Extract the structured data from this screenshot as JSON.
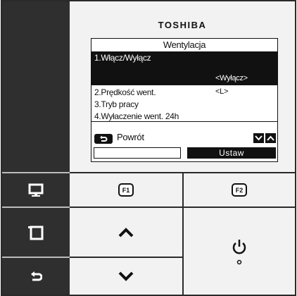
{
  "brand": "TOSHIBA",
  "screen": {
    "title": "Wentylacja",
    "selected_item": {
      "label": "1.Włącz/Wyłącz",
      "value": "<Wyłącz>"
    },
    "items": [
      {
        "label": "2.Prędkość went.",
        "value": "<L>"
      },
      {
        "label": "3.Tryb pracy",
        "value": ""
      },
      {
        "label": "4.Wyłaczenie went. 24h",
        "value": ""
      }
    ],
    "back_label": "Powrót",
    "left_softkey": "",
    "right_softkey": "Ustaw"
  },
  "buttons": {
    "f1": "F1",
    "f2": "F2"
  },
  "icons": {
    "monitor": "monitor-icon",
    "menu": "menu-icon",
    "back": "back-icon",
    "up": "up-arrow-icon",
    "down": "down-arrow-icon",
    "power": "power-icon"
  },
  "colors": {
    "panel_dark": "#2f2f2f",
    "panel_light": "#f2f2f2",
    "lcd_bg": "#ffffff",
    "lcd_ink": "#111111"
  }
}
